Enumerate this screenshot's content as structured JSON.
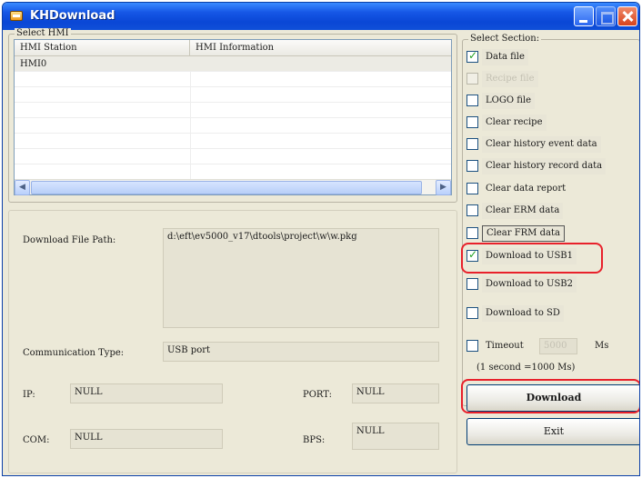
{
  "window": {
    "title": "KHDownload"
  },
  "select_hmi": {
    "group_label": "Select HMI",
    "columns": [
      "HMI Station",
      "HMI Information"
    ],
    "rows": [
      {
        "station": "HMI0",
        "info": ""
      }
    ]
  },
  "path_section": {
    "download_path_label": "Download File Path:",
    "download_path_value": "d:\\eft\\ev5000_v17\\dtools\\project\\w\\w.pkg",
    "comm_type_label": "Communication Type:",
    "comm_type_value": "USB port",
    "ip_label": "IP:",
    "ip_value": "NULL",
    "port_label": "PORT:",
    "port_value": "NULL",
    "com_label": "COM:",
    "com_value": "NULL",
    "bps_label": "BPS:",
    "bps_value": "NULL"
  },
  "select_section": {
    "group_label": "Select Section:",
    "options": [
      {
        "label": "Data file",
        "checked": true,
        "disabled": false
      },
      {
        "label": "Recipe file",
        "checked": false,
        "disabled": true
      },
      {
        "label": "LOGO file",
        "checked": false,
        "disabled": false
      },
      {
        "label": "Clear recipe",
        "checked": false,
        "disabled": false
      },
      {
        "label": "Clear history event data",
        "checked": false,
        "disabled": false
      },
      {
        "label": "Clear history record data",
        "checked": false,
        "disabled": false
      },
      {
        "label": "Clear data report",
        "checked": false,
        "disabled": false
      },
      {
        "label": "Clear ERM data",
        "checked": false,
        "disabled": false
      },
      {
        "label": "Clear FRM data",
        "checked": false,
        "disabled": false
      },
      {
        "label": "Download to USB1",
        "checked": true,
        "disabled": false
      },
      {
        "label": "Download to USB2",
        "checked": false,
        "disabled": false
      },
      {
        "label": "Download to SD",
        "checked": false,
        "disabled": false
      }
    ],
    "timeout": {
      "label": "Timeout",
      "value": "5000",
      "unit": "Ms",
      "checked": false,
      "note": "(1 second =1000 Ms)"
    }
  },
  "buttons": {
    "download": "Download",
    "exit": "Exit"
  },
  "colors": {
    "titlebar": "#0a47d6",
    "window_bg": "#ece9d8",
    "highlight": "#e8212b"
  }
}
